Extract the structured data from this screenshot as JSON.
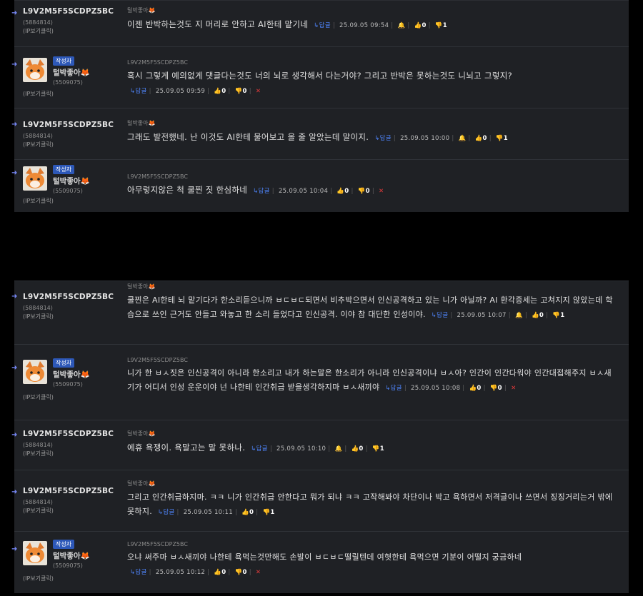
{
  "anon_user": {
    "name": "L9V2M5F5SCDPZ5BC",
    "id": "(5884814)",
    "ip": "(IP보기클릭)"
  },
  "author_user": {
    "badge": "작성자",
    "name": "털박좋아",
    "id": "(5509075)",
    "ip": "(IP보기클릭)"
  },
  "meta_author": "털박좋아",
  "meta_anon": "L9V2M5F5SCDPZ5BC",
  "reply_label": "↳답글",
  "comments": [
    {
      "text": "이젠 반박하는것도 지 머리로 안하고 AI한테 맡기네",
      "date": "25.09.05 09:54",
      "up": "0",
      "down": "1"
    },
    {
      "text": "혹시 그렇게 예의없게 댓글다는것도 너의 뇌로 생각해서 다는거야? 그리고 반박은 못하는것도 니뇌고 그렇지?",
      "date": "25.09.05 09:59",
      "up": "0",
      "down": "0"
    },
    {
      "text": "그래도 발전했네. 난 이것도 AI한테 물어보고 올 줄 알았는데 말이지.",
      "date": "25.09.05 10:00",
      "up": "0",
      "down": "1"
    },
    {
      "text": "아무렇지않은 척 쿨찐 짓 한심하네",
      "date": "25.09.05 10:04",
      "up": "0",
      "down": "0"
    },
    {
      "text": "쿨찐은 AI한테 뇌 맡기다가 한소리듣으니까 ㅂㄷㅂㄷ되면서 비추박으면서 인신공격하고 있는 니가 아닐까? AI 환각증세는 고쳐지지 않았는데 학습으로 쓰인 근거도 안들고 와놓고 한 소리 들었다고 인신공격. 이야 참 대단한 인성이야.",
      "date": "25.09.05 10:07",
      "up": "0",
      "down": "1"
    },
    {
      "text": "니가 한 ㅂㅅ짓은 인신공격이 아니라 한소리고 내가 하는말은 한소리가 아니라 인신공격이냐 ㅂㅅ아? 인간이 인간다워야 인간대접해주지 ㅂㅅ새기가 어디서 인성 운운이야 넌 나한테 인간취급 받을생각하지마 ㅂㅅ새끼야",
      "date": "25.09.05 10:08",
      "up": "0",
      "down": "0"
    },
    {
      "text": "에휴 욕쟁이. 욕말고는 말 못하나.",
      "date": "25.09.05 10:10",
      "up": "0",
      "down": "1"
    },
    {
      "text": "그리고 인간취급하지마. ㅋㅋ 니가 인간취급 안한다고 뭐가 되냐 ㅋㅋ 고작해봐야 차단이나 박고 욕하면서 저격글이나 쓰면서 징징거리는거 밖에 못하지.",
      "date": "25.09.05 10:11",
      "up": "0",
      "down": "1"
    },
    {
      "text": "오냐 써주마 ㅂㅅ새끼야 나한테 욕먹는것만해도 손발이 ㅂㄷㅂㄷ떨릴텐데 여혓한테 욕먹으면 기분이 어떨지 궁금하네",
      "date": "25.09.05 10:12",
      "up": "0",
      "down": "0"
    }
  ]
}
